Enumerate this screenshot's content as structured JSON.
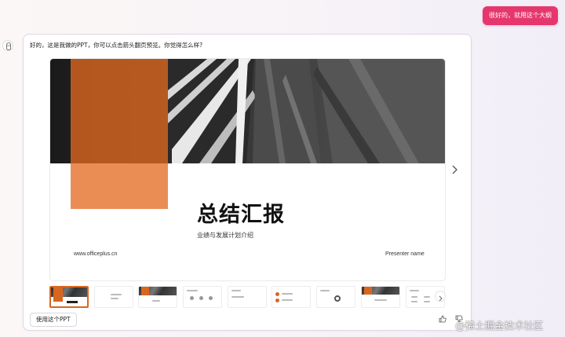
{
  "user_message": "很好的，就用这个大纲",
  "assistant": {
    "message": "好的，这是我做的PPT，你可以点击箭头翻页预览。你觉得怎么样?",
    "use_button_label": "使用这个PPT"
  },
  "slide": {
    "title": "总结汇报",
    "subtitle": "业绩与发展计划介绍",
    "website": "www.officeplus.cn",
    "presenter": "Presenter name"
  },
  "thumbnails": {
    "count": 10,
    "active_index": 0
  },
  "icons": {
    "next_slide": "chevron-right-icon",
    "thumbs_up": "thumbs-up-icon",
    "thumbs_down": "thumbs-down-icon",
    "avatar": "assistant-avatar-icon"
  },
  "watermark": "@稀土掘金技术社区",
  "colors": {
    "user_bubble": "#e5376d",
    "accent_orange": "#d9661f",
    "light_orange": "#ea8d55"
  }
}
